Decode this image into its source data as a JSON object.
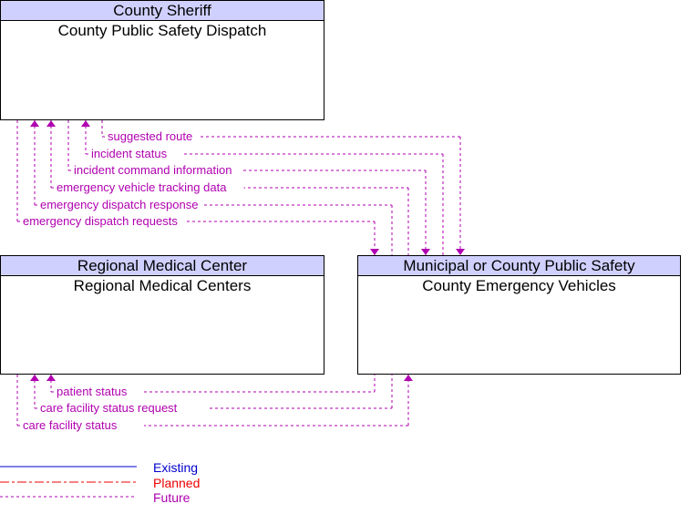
{
  "boxes": [
    {
      "id": "dispatch",
      "header": "County Sheriff",
      "name": "County Public Safety Dispatch"
    },
    {
      "id": "medical",
      "header": "Regional Medical Center",
      "name": "Regional Medical Centers"
    },
    {
      "id": "vehicles",
      "header": "Municipal or County Public Safety",
      "name": "County Emergency Vehicles"
    }
  ],
  "flows": [
    {
      "label": "suggested route",
      "from": "County Public Safety Dispatch",
      "to": "County Emergency Vehicles",
      "status": "Future"
    },
    {
      "label": "incident status",
      "from": "County Emergency Vehicles",
      "to": "County Public Safety Dispatch",
      "status": "Future"
    },
    {
      "label": "incident command information",
      "from": "County Public Safety Dispatch",
      "to": "County Emergency Vehicles",
      "status": "Future"
    },
    {
      "label": "emergency vehicle tracking data",
      "from": "County Emergency Vehicles",
      "to": "County Public Safety Dispatch",
      "status": "Future"
    },
    {
      "label": "emergency dispatch response",
      "from": "County Emergency Vehicles",
      "to": "County Public Safety Dispatch",
      "status": "Future"
    },
    {
      "label": "emergency dispatch requests",
      "from": "County Public Safety Dispatch",
      "to": "County Emergency Vehicles",
      "status": "Future"
    },
    {
      "label": "patient status",
      "from": "County Emergency Vehicles",
      "to": "Regional Medical Centers",
      "status": "Future"
    },
    {
      "label": "care facility status request",
      "from": "County Emergency Vehicles",
      "to": "Regional Medical Centers",
      "status": "Future"
    },
    {
      "label": "care facility status",
      "from": "Regional Medical Centers",
      "to": "County Emergency Vehicles",
      "status": "Future"
    }
  ],
  "legend": [
    {
      "label": "Existing",
      "color": "#0000cc",
      "style": "solid"
    },
    {
      "label": "Planned",
      "color": "#ee0000",
      "style": "dash-dot"
    },
    {
      "label": "Future",
      "color": "#b000b0",
      "style": "dashed"
    }
  ],
  "colors": {
    "flow": "#b000b0",
    "header_bg": "#d0d0ff"
  }
}
